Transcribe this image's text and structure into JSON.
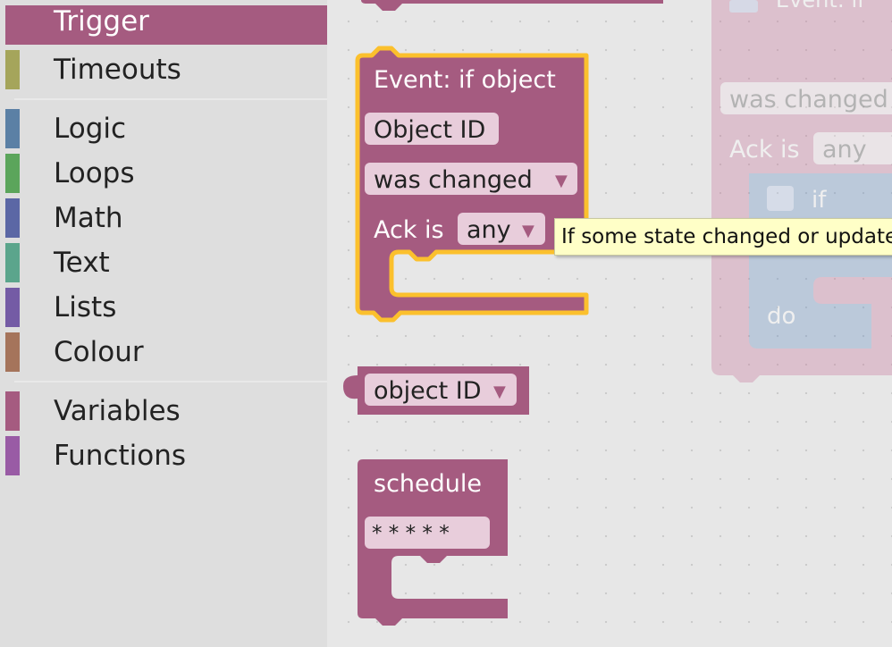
{
  "toolbox": {
    "categories": [
      {
        "label": "Trigger",
        "color": "#a55b80",
        "selected": true
      },
      {
        "label": "Timeouts",
        "color": "#a5a55b"
      },
      {
        "label": "Logic",
        "color": "#5b80a5"
      },
      {
        "label": "Loops",
        "color": "#5ba55b"
      },
      {
        "label": "Math",
        "color": "#5b67a5"
      },
      {
        "label": "Text",
        "color": "#5ba58c"
      },
      {
        "label": "Lists",
        "color": "#745ba5"
      },
      {
        "label": "Colour",
        "color": "#a5745b"
      },
      {
        "label": "Variables",
        "color": "#a55b80"
      },
      {
        "label": "Functions",
        "color": "#995ba5"
      }
    ]
  },
  "blocks": {
    "event_block": {
      "title": "Event: if object",
      "object_id_field": "Object ID",
      "change_dropdown": "was changed",
      "ack_label": "Ack is",
      "ack_dropdown": "any"
    },
    "object_id_block": {
      "dropdown": "object ID"
    },
    "schedule_block": {
      "title": "schedule",
      "cron_field": "* * * * *"
    },
    "ghost_block": {
      "title": "Event: if",
      "change_dropdown": "was changed",
      "ack_label": "Ack is",
      "ack_dropdown": "any",
      "if_label": "if",
      "do_label": "do"
    }
  },
  "tooltip": {
    "text": "If some state changed or updated"
  },
  "colors": {
    "block": "#a55b80",
    "field": "#e0c3d2",
    "highlight": "#fbc02d",
    "logic": "#5b80a5"
  }
}
